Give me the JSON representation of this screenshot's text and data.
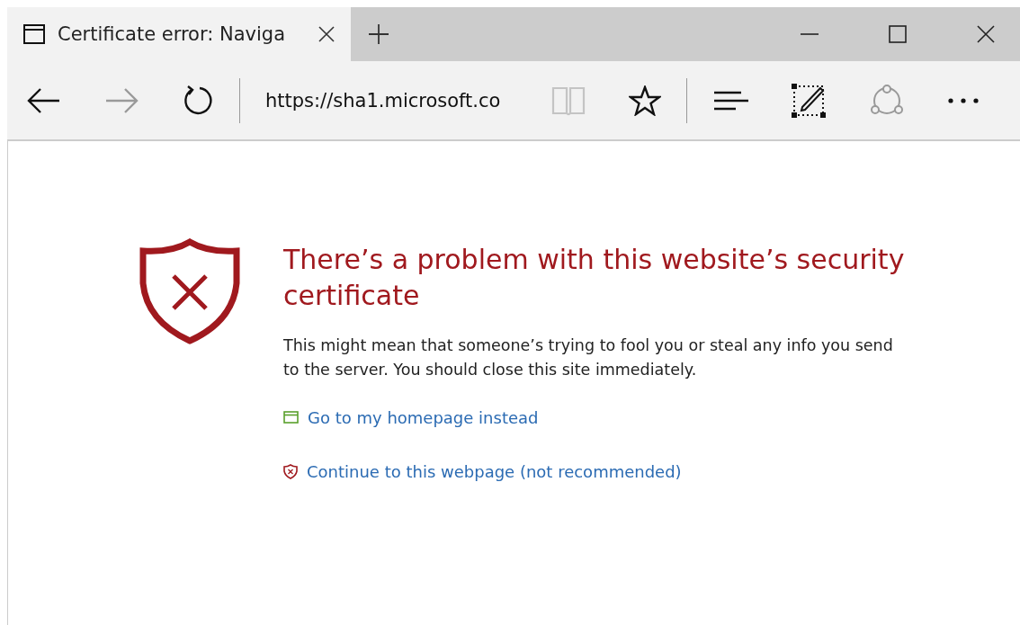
{
  "tab": {
    "title": "Certificate error: Naviga",
    "selected": true
  },
  "toolbar": {
    "back": {
      "disabled": false
    },
    "forward": {
      "disabled": true
    },
    "url": "https://sha1.microsoft.co",
    "reading_view": {
      "disabled": true
    }
  },
  "error": {
    "heading": "There’s a problem with this website’s security certificate",
    "message": "This might mean that someone’s trying to fool you or steal any info you send to the server. You should close this site immediately.",
    "links": [
      {
        "kind": "home",
        "label": "Go to my homepage instead"
      },
      {
        "kind": "continue",
        "label": "Continue to this webpage (not recommended)"
      }
    ]
  }
}
